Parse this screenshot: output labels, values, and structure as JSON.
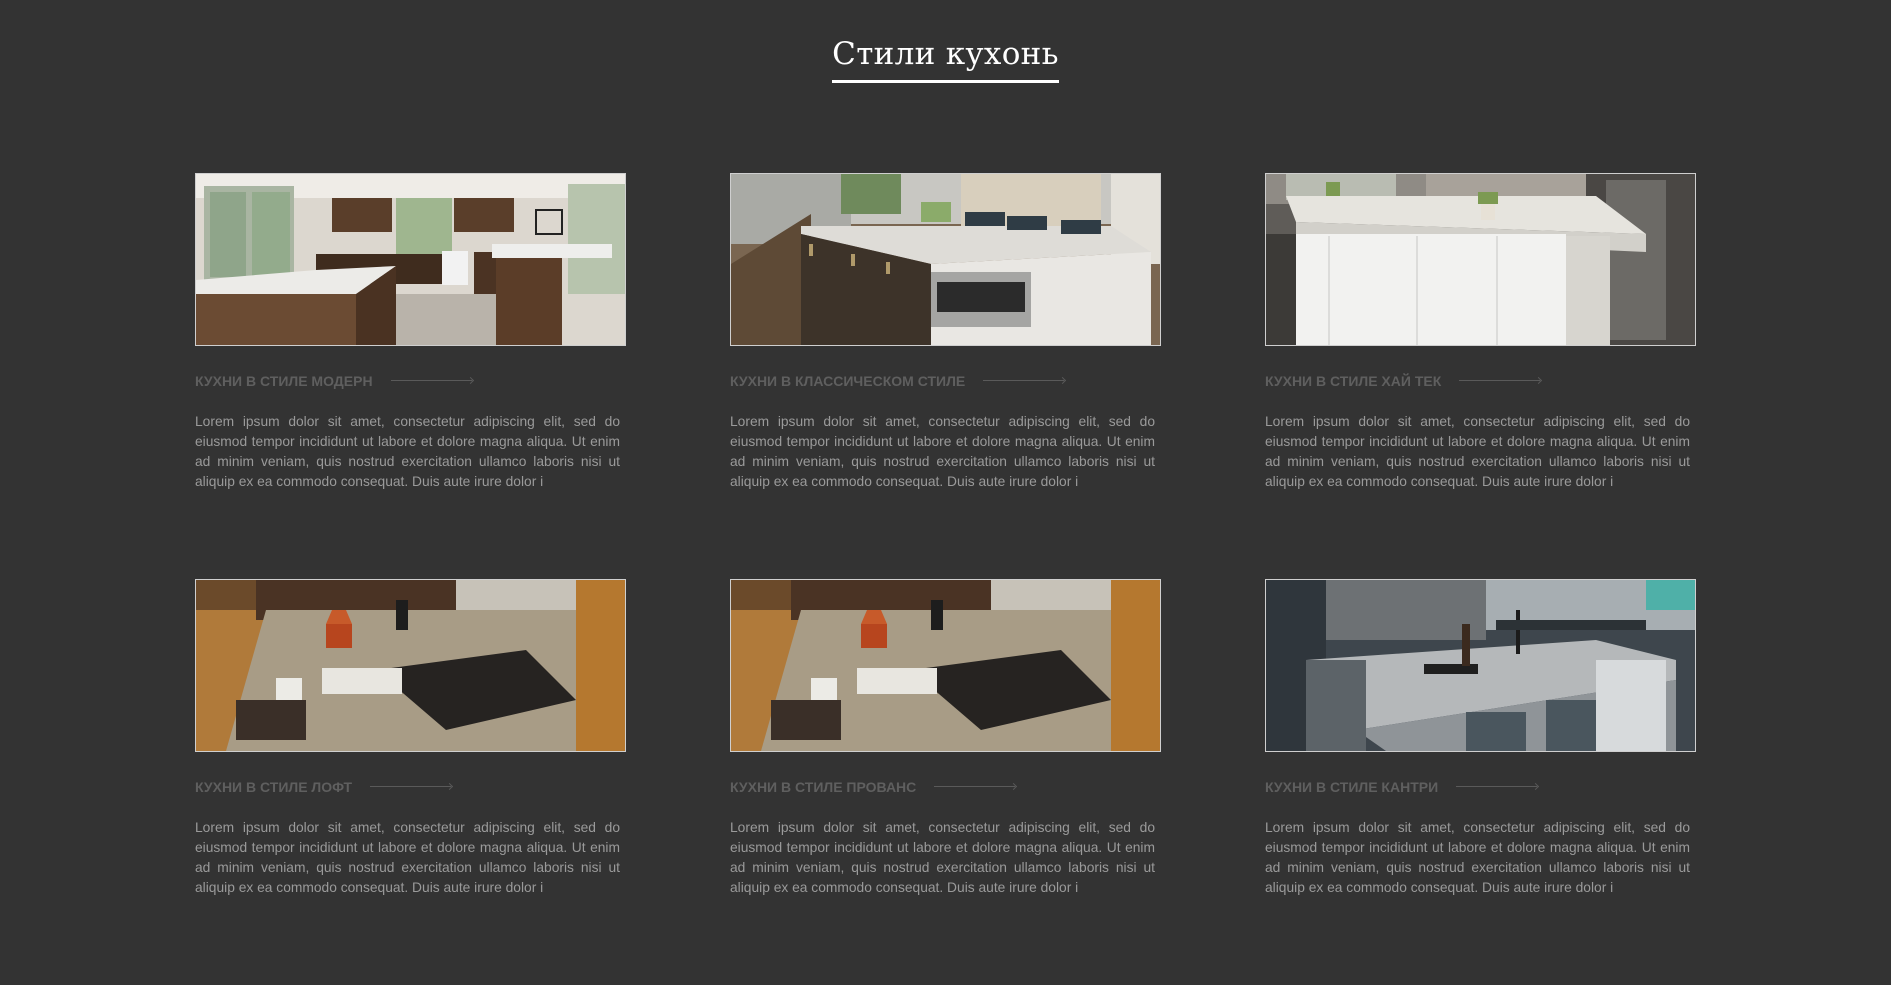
{
  "page": {
    "title": "Стили кухонь"
  },
  "cards": [
    {
      "title": "Кухни в стиле модерн",
      "text": "Lorem ipsum dolor sit amet, consectetur adipiscing elit, sed do eiusmod tempor incididunt ut labore et dolore magna aliqua. Ut enim ad minim veniam, quis nostrud exercitation ullamco laboris nisi ut aliquip ex ea commodo consequat. Duis aute irure dolor i"
    },
    {
      "title": "Кухни в классическом стиле",
      "text": "Lorem ipsum dolor sit amet, consectetur adipiscing elit, sed do eiusmod tempor incididunt ut labore et dolore magna aliqua. Ut enim ad minim veniam, quis nostrud exercitation ullamco laboris nisi ut aliquip ex ea commodo consequat. Duis aute irure dolor i"
    },
    {
      "title": "Кухни в стиле хай тек",
      "text": "Lorem ipsum dolor sit amet, consectetur adipiscing elit, sed do eiusmod tempor incididunt ut labore et dolore magna aliqua. Ut enim ad minim veniam, quis nostrud exercitation ullamco laboris nisi ut aliquip ex ea commodo consequat. Duis aute irure dolor i"
    },
    {
      "title": "Кухни в стиле лофт",
      "text": "Lorem ipsum dolor sit amet, consectetur adipiscing elit, sed do eiusmod tempor incididunt ut labore et dolore magna aliqua. Ut enim ad minim veniam, quis nostrud exercitation ullamco laboris nisi ut aliquip ex ea commodo consequat. Duis aute irure dolor i"
    },
    {
      "title": "Кухни в стиле прованс",
      "text": "Lorem ipsum dolor sit amet, consectetur adipiscing elit, sed do eiusmod tempor incididunt ut labore et dolore magna aliqua. Ut enim ad minim veniam, quis nostrud exercitation ullamco laboris nisi ut aliquip ex ea commodo consequat. Duis aute irure dolor i"
    },
    {
      "title": "Кухни в стиле кантри",
      "text": "Lorem ipsum dolor sit amet, consectetur adipiscing elit, sed do eiusmod tempor incididunt ut labore et dolore magna aliqua. Ut enim ad minim veniam, quis nostrud exercitation ullamco laboris nisi ut aliquip ex ea commodo consequat. Duis aute irure dolor i"
    }
  ],
  "colors": {
    "background": "#333333",
    "title": "#ffffff",
    "card_title": "#5f5f5f",
    "card_text": "#9a9a9a",
    "image_border": "#cfcfcf"
  }
}
